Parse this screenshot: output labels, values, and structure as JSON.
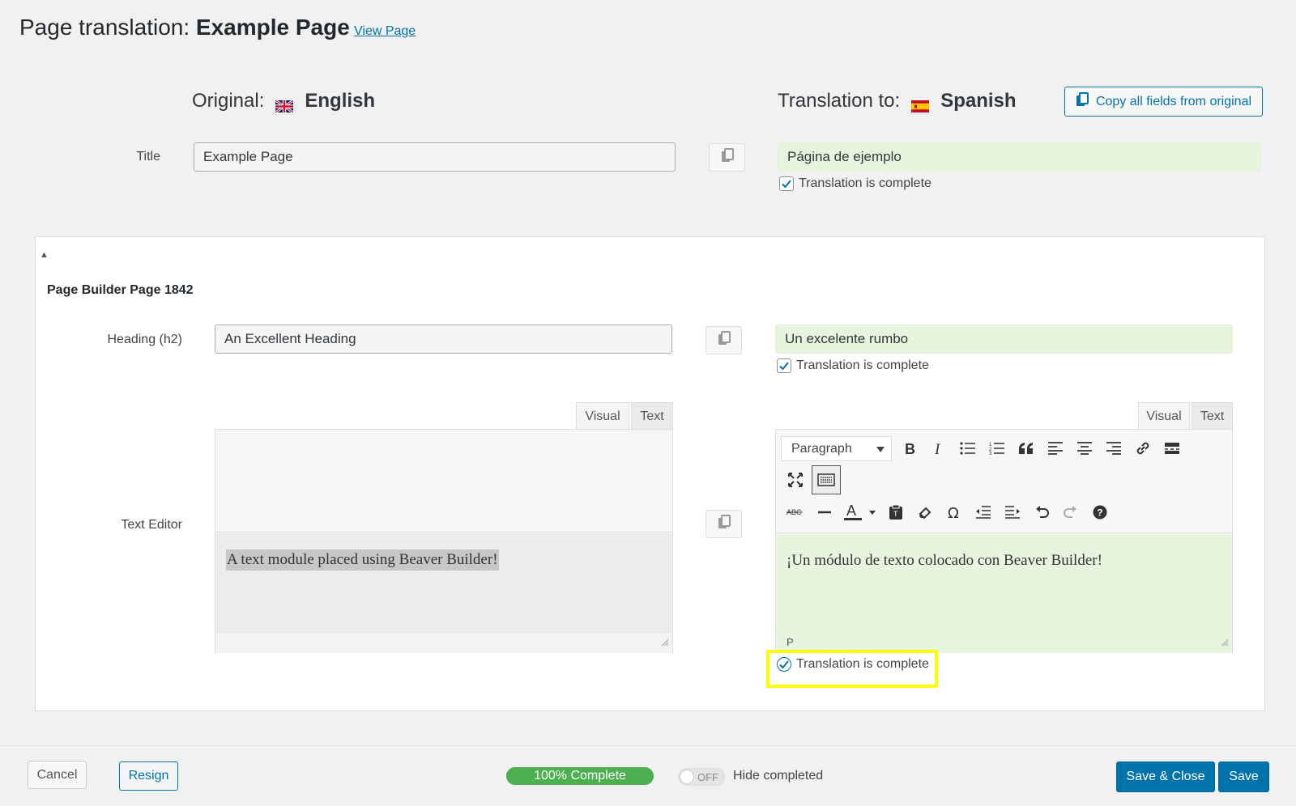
{
  "header": {
    "title_prefix": "Page translation:",
    "title_page": "Example Page",
    "view_page_link": "View Page"
  },
  "languages": {
    "original_label": "Original:",
    "original_name": "English",
    "translation_label": "Translation to:",
    "translation_name": "Spanish",
    "copy_all_label": "Copy all fields from original"
  },
  "title_field": {
    "label": "Title",
    "original_value": "Example Page",
    "translation_value": "Página de ejemplo",
    "complete_label": "Translation is complete",
    "complete_checked": true
  },
  "panel": {
    "toggle_glyph": "▲",
    "title": "Page Builder Page 1842",
    "heading_field": {
      "label": "Heading (h2)",
      "original_value": "An Excellent Heading",
      "translation_value": "Un excelente rumbo",
      "complete_label": "Translation is complete",
      "complete_checked": true
    },
    "text_editor_field": {
      "label": "Text Editor",
      "tab_visual": "Visual",
      "tab_text": "Text",
      "original_value": "A text module placed using Beaver Builder!",
      "translation_value": "¡Un módulo de texto colocado con Beaver Builder!",
      "format_select": "Paragraph",
      "status_path": "P",
      "complete_label": "Translation is complete",
      "complete_checked": true
    }
  },
  "footer": {
    "cancel_label": "Cancel",
    "resign_label": "Resign",
    "progress_label": "100% Complete",
    "progress_percent": 100,
    "toggle_label": "OFF",
    "hide_completed_label": "Hide completed",
    "save_close_label": "Save & Close",
    "save_label": "Save"
  },
  "colors": {
    "accent": "#0073aa",
    "translated_bg": "#e7f5df",
    "progress": "#46b450",
    "highlight": "#ffff00"
  }
}
